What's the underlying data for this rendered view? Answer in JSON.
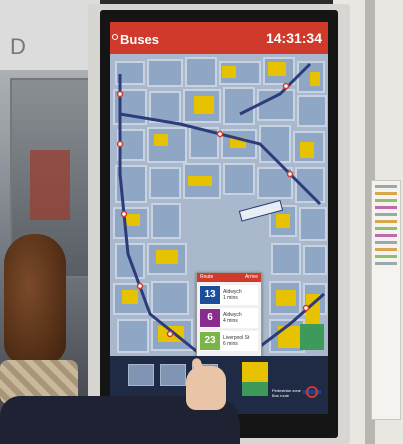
{
  "screen": {
    "title": "Buses",
    "clock": "14:31:34"
  },
  "journey_card": {
    "header_left": "Route",
    "header_right": "Arrive",
    "routes": [
      {
        "number": "13",
        "destination": "Aldwych\n1 mins",
        "color": "#1b4f9c"
      },
      {
        "number": "6",
        "destination": "Aldwych\n4 mins",
        "color": "#8a2c8e"
      },
      {
        "number": "23",
        "destination": "Liverpool St\n6 mins",
        "color": "#7ab54a"
      }
    ]
  },
  "bottom_bar": {
    "legend_text": "Pedestrian zone  Bus route",
    "logo": "roundel-logo"
  },
  "colors": {
    "header_red": "#d03a2b",
    "map_blocks": "#8fa6c4",
    "buildings_yellow": "#e6c200",
    "route_blue": "#2d3b7a"
  }
}
